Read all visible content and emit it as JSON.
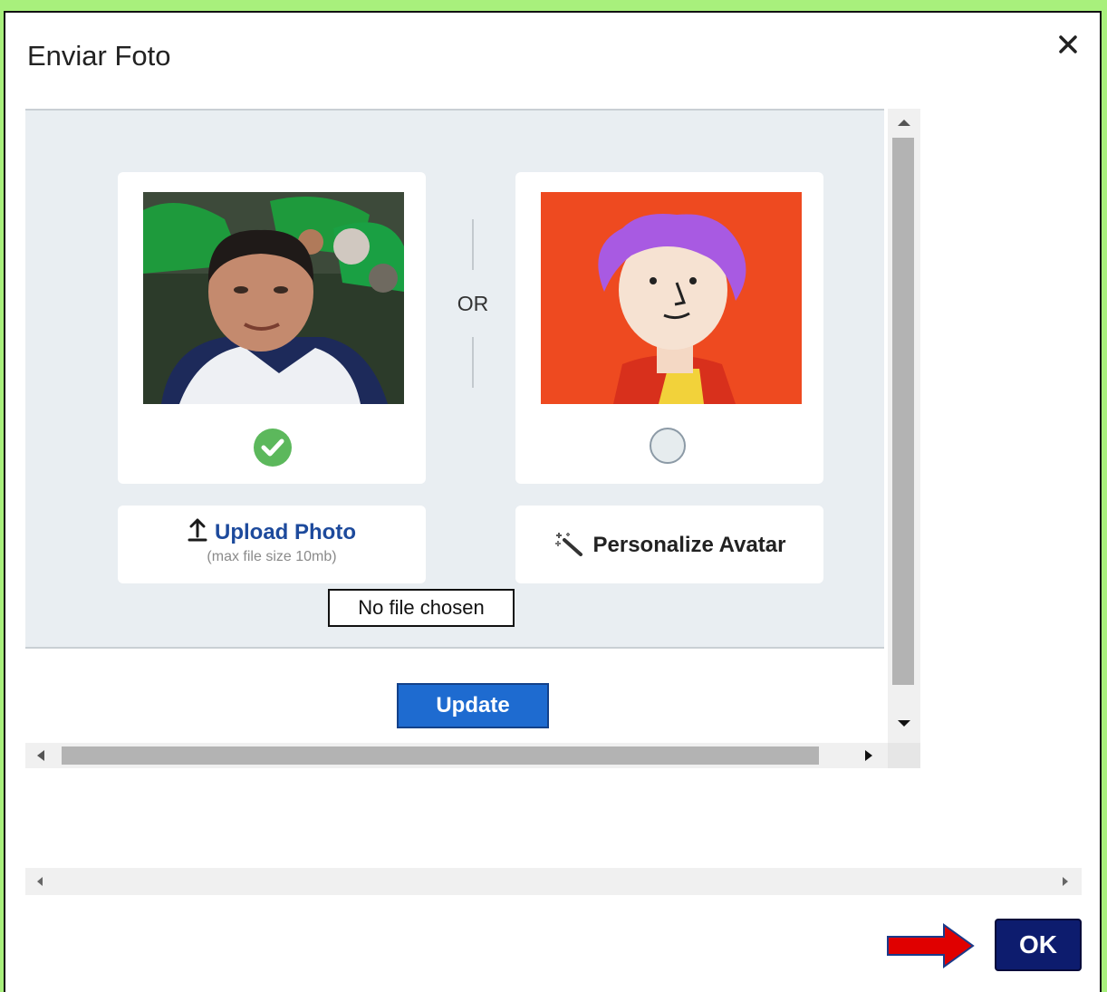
{
  "dialog": {
    "title": "Enviar Foto",
    "close_icon": "close-icon"
  },
  "photo_option": {
    "selected": true,
    "selected_icon": "check-circle-icon"
  },
  "separator": {
    "label": "OR"
  },
  "avatar_option": {
    "selected": false
  },
  "upload": {
    "icon": "upload-icon",
    "label": "Upload Photo",
    "hint": "(max file size 10mb)",
    "file_status": "No file chosen"
  },
  "personalize": {
    "icon": "magic-wand-icon",
    "label": "Personalize Avatar"
  },
  "update_button": {
    "label": "Update"
  },
  "ok_button": {
    "label": "OK"
  },
  "colors": {
    "page_background": "#a8f07c",
    "panel_background": "#e9eef2",
    "update_button": "#1e6bd0",
    "ok_button": "#0d1c6e",
    "upload_text": "#1d4a9c",
    "selected_check": "#5cb85c",
    "avatar_background": "#ee4a20",
    "annotation_arrow": "#e00000"
  }
}
